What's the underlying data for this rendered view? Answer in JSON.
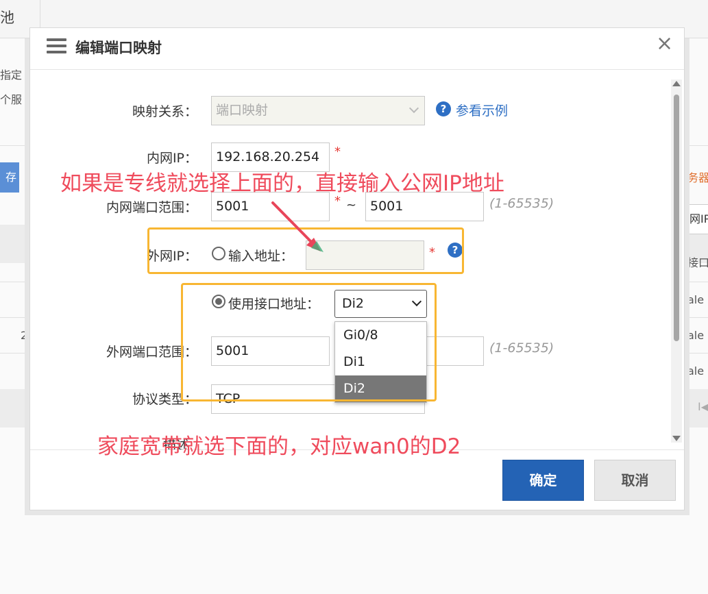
{
  "background": {
    "tab_fragment": "池",
    "left_fragments": [
      "指定",
      "个服"
    ],
    "left_button_fragment": "存",
    "row_number_fragment": "2",
    "right_fragments": [
      "务器",
      "网IP",
      "接口",
      "ale",
      "ale",
      "ale"
    ],
    "pager_fragment": "I◀"
  },
  "modal": {
    "title": "编辑端口映射",
    "close_symbol": "×",
    "mapping_relation": {
      "label": "映射关系：",
      "value": "端口映射",
      "help_link": "参看示例"
    },
    "internal_ip": {
      "label": "内网IP：",
      "value": "192.168.20.254",
      "required": "*"
    },
    "internal_port_range": {
      "label": "内网端口范围：",
      "from": "5001",
      "to": "5001",
      "required": "*",
      "separator": "~",
      "hint": "(1-65535)"
    },
    "external_ip": {
      "label": "外网IP：",
      "option_input_address": "输入地址：",
      "address_value": "",
      "required": "*",
      "option_use_interface": "使用接口地址：",
      "selected_interface": "Di2",
      "interface_options": [
        "Gi0/8",
        "Di1",
        "Di2"
      ]
    },
    "external_port_range": {
      "label": "外网端口范围：",
      "from": "5001",
      "hint": "(1-65535)"
    },
    "protocol": {
      "label": "协议类型：",
      "value": "TCP"
    },
    "description_label_fragment": "描述",
    "confirm_label": "确定",
    "cancel_label": "取消"
  },
  "annotations": {
    "top_note": "如果是专线就选择上面的，直接输入公网IP地址",
    "bottom_note": "家庭宽带就选下面的，对应wan0的D2",
    "highlight_color": "#f8b632",
    "annotation_color": "#ef4b5c",
    "arrow_color": "#e8455a"
  },
  "colors": {
    "primary_button": "#2463b5",
    "help_icon": "#2e6fc4",
    "required_star": "#e53935"
  }
}
